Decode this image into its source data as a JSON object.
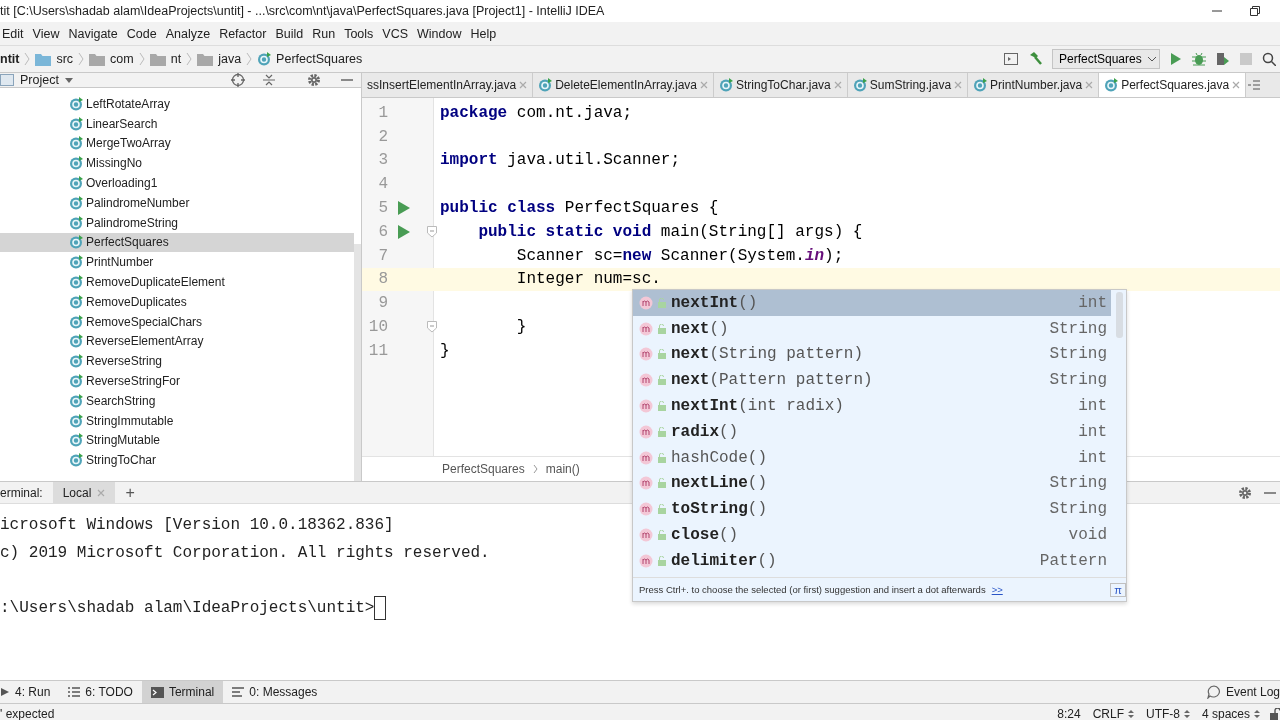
{
  "window": {
    "title": "tit [C:\\Users\\shadab alam\\IdeaProjects\\untit] - ...\\src\\com\\nt\\java\\PerfectSquares.java [Project1] - IntelliJ IDEA"
  },
  "menu": [
    "Edit",
    "View",
    "Navigate",
    "Code",
    "Analyze",
    "Refactor",
    "Build",
    "Run",
    "Tools",
    "VCS",
    "Window",
    "Help"
  ],
  "nav_bar": {
    "items": [
      {
        "label": "ntit",
        "kind": "project"
      },
      {
        "label": "src",
        "kind": "source"
      },
      {
        "label": "com",
        "kind": "folder"
      },
      {
        "label": "nt",
        "kind": "folder"
      },
      {
        "label": "java",
        "kind": "folder"
      },
      {
        "label": "PerfectSquares",
        "kind": "class"
      }
    ],
    "run_config": "PerfectSquares"
  },
  "project_panel": {
    "title": "Project",
    "items": [
      {
        "label": "LeftRotateArray",
        "selected": false
      },
      {
        "label": "LinearSearch",
        "selected": false
      },
      {
        "label": "MergeTwoArray",
        "selected": false
      },
      {
        "label": "MissingNo",
        "selected": false
      },
      {
        "label": "Overloading1",
        "selected": false
      },
      {
        "label": "PalindromeNumber",
        "selected": false
      },
      {
        "label": "PalindromeString",
        "selected": false
      },
      {
        "label": "PerfectSquares",
        "selected": true
      },
      {
        "label": "PrintNumber",
        "selected": false
      },
      {
        "label": "RemoveDuplicateElement",
        "selected": false
      },
      {
        "label": "RemoveDuplicates",
        "selected": false
      },
      {
        "label": "RemoveSpecialChars",
        "selected": false
      },
      {
        "label": "ReverseElementArray",
        "selected": false
      },
      {
        "label": "ReverseString",
        "selected": false
      },
      {
        "label": "ReverseStringFor",
        "selected": false
      },
      {
        "label": "SearchString",
        "selected": false
      },
      {
        "label": "StringImmutable",
        "selected": false
      },
      {
        "label": "StringMutable",
        "selected": false
      },
      {
        "label": "StringToChar",
        "selected": false
      }
    ]
  },
  "editor": {
    "tabs": [
      {
        "label": "ssInsertElementInArray.java",
        "selected": false,
        "cut": true
      },
      {
        "label": "DeleteElementInArray.java",
        "selected": false,
        "cut": false
      },
      {
        "label": "StringToChar.java",
        "selected": false,
        "cut": false
      },
      {
        "label": "SumString.java",
        "selected": false,
        "cut": false
      },
      {
        "label": "PrintNumber.java",
        "selected": false,
        "cut": false
      },
      {
        "label": "PerfectSquares.java",
        "selected": true,
        "cut": false
      }
    ],
    "lines": [
      {
        "number": "1",
        "code": "**package** com.nt.java;",
        "run": false,
        "fold": false,
        "current": false
      },
      {
        "number": "2",
        "run": false,
        "fold": false,
        "current": false
      },
      {
        "number": "3",
        "code": "**import** java.util.Scanner;",
        "run": false,
        "fold": false,
        "current": false
      },
      {
        "number": "4",
        "run": false,
        "fold": false,
        "current": false
      },
      {
        "number": "5",
        "code": "**public class** PerfectSquares {",
        "run": true,
        "fold": false,
        "current": false
      },
      {
        "number": "6",
        "code": "    **public static void** main(String[] args) {",
        "run": true,
        "fold": true,
        "current": false
      },
      {
        "number": "7",
        "code": "        Scanner sc=**new** Scanner(System.*in*);",
        "run": false,
        "fold": false,
        "current": false
      },
      {
        "number": "8",
        "code": "        Integer num=sc.",
        "run": false,
        "fold": false,
        "current": true
      },
      {
        "number": "9",
        "run": false,
        "fold": false,
        "current": false
      },
      {
        "number": "10",
        "code": "        }",
        "run": false,
        "fold": true,
        "current": false
      },
      {
        "number": "11",
        "code": "}",
        "run": false,
        "fold": false,
        "current": false
      }
    ],
    "breadcrumb": [
      "PerfectSquares",
      "main()"
    ]
  },
  "completion": {
    "items": [
      {
        "text": "**nextInt**()",
        "type": "int",
        "selected": true
      },
      {
        "text": "**next**()",
        "type": "String",
        "selected": false
      },
      {
        "text": "**next**(String pattern)",
        "type": "String",
        "selected": false
      },
      {
        "text": "**next**(Pattern pattern)",
        "type": "String",
        "selected": false
      },
      {
        "text": "**nextInt**(int radix)",
        "type": "int",
        "selected": false
      },
      {
        "text": "**radix**()",
        "type": "int",
        "selected": false
      },
      {
        "text": "hashCode()",
        "type": "int",
        "selected": false
      },
      {
        "text": "**nextLine**()",
        "type": "String",
        "selected": false
      },
      {
        "text": "**toString**()",
        "type": "String",
        "selected": false
      },
      {
        "text": "**close**()",
        "type": "void",
        "selected": false
      },
      {
        "text": "**delimiter**()",
        "type": "Pattern",
        "selected": false
      }
    ],
    "hint": "Press Ctrl+. to choose the selected (or first) suggestion and insert a dot afterwards",
    "hint_link": ">>",
    "corner": "π"
  },
  "terminal": {
    "label": "erminal:",
    "tabs": [
      {
        "label": "Local",
        "selected": true
      }
    ],
    "add": "+",
    "lines": [
      {
        "text": "icrosoft Windows [Version 10.0.18362.836]",
        "kind": "output"
      },
      {
        "text": "c) 2019 Microsoft Corporation. All rights reserved.",
        "kind": "output"
      },
      {
        "text": ":\\Users\\shadab alam\\IdeaProjects\\untit>",
        "kind": "prompt"
      }
    ]
  },
  "tool_windows": [
    {
      "label": "4: Run",
      "kind": "run",
      "selected": false
    },
    {
      "label": "6: TODO",
      "kind": "todo",
      "selected": false
    },
    {
      "label": "Terminal",
      "kind": "terminal",
      "selected": true
    },
    {
      "label": "0: Messages",
      "kind": "messages",
      "selected": false
    }
  ],
  "event_log": "Event Log",
  "status_bar": {
    "message": "' expected",
    "position": "8:24",
    "line_separator": "CRLF",
    "encoding": "UTF-8",
    "indent": "4 spaces"
  }
}
